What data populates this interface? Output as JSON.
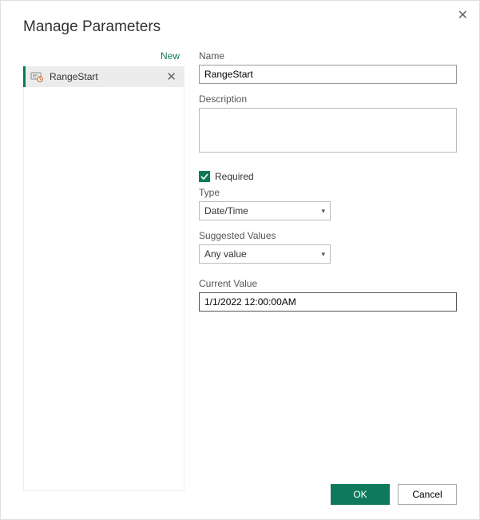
{
  "dialog": {
    "title": "Manage Parameters",
    "close_tooltip": "Close"
  },
  "sidebar": {
    "new_link": "New",
    "items": [
      {
        "label": "RangeStart"
      }
    ]
  },
  "form": {
    "name_label": "Name",
    "name_value": "RangeStart",
    "description_label": "Description",
    "description_value": "",
    "required_label": "Required",
    "required_checked": true,
    "type_label": "Type",
    "type_value": "Date/Time",
    "suggested_label": "Suggested Values",
    "suggested_value": "Any value",
    "current_value_label": "Current Value",
    "current_value": "1/1/2022 12:00:00AM"
  },
  "footer": {
    "ok": "OK",
    "cancel": "Cancel"
  }
}
